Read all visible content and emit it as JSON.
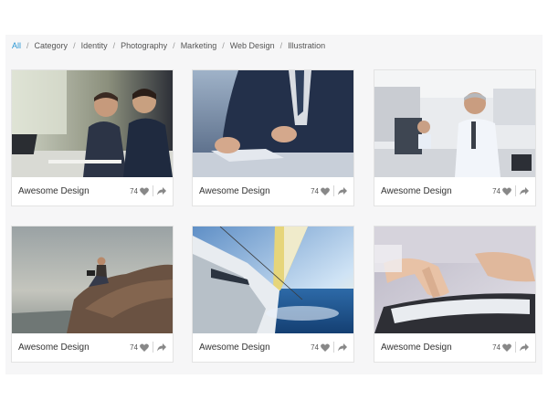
{
  "filters": [
    {
      "label": "All",
      "active": true
    },
    {
      "label": "Category",
      "active": false
    },
    {
      "label": "Identity",
      "active": false
    },
    {
      "label": "Photography",
      "active": false
    },
    {
      "label": "Marketing",
      "active": false
    },
    {
      "label": "Web Design",
      "active": false
    },
    {
      "label": "Illustration",
      "active": false
    }
  ],
  "colors": {
    "accent": "#2a96d4",
    "text": "#333333"
  },
  "cards": [
    {
      "title": "Awesome Design",
      "likes": "74",
      "image": "business-meeting-photo",
      "like_icon": "heart-icon",
      "share_icon": "share-icon"
    },
    {
      "title": "Awesome Design",
      "likes": "74",
      "image": "businessman-tablet-photo",
      "like_icon": "heart-icon",
      "share_icon": "share-icon"
    },
    {
      "title": "Awesome Design",
      "likes": "74",
      "image": "office-workers-photo",
      "like_icon": "heart-icon",
      "share_icon": "share-icon"
    },
    {
      "title": "Awesome Design",
      "likes": "74",
      "image": "man-on-rock-laptop-photo",
      "like_icon": "heart-icon",
      "share_icon": "share-icon"
    },
    {
      "title": "Awesome Design",
      "likes": "74",
      "image": "sailboat-photo",
      "like_icon": "heart-icon",
      "share_icon": "share-icon"
    },
    {
      "title": "Awesome Design",
      "likes": "74",
      "image": "hand-on-tablet-photo",
      "like_icon": "heart-icon",
      "share_icon": "share-icon"
    }
  ]
}
